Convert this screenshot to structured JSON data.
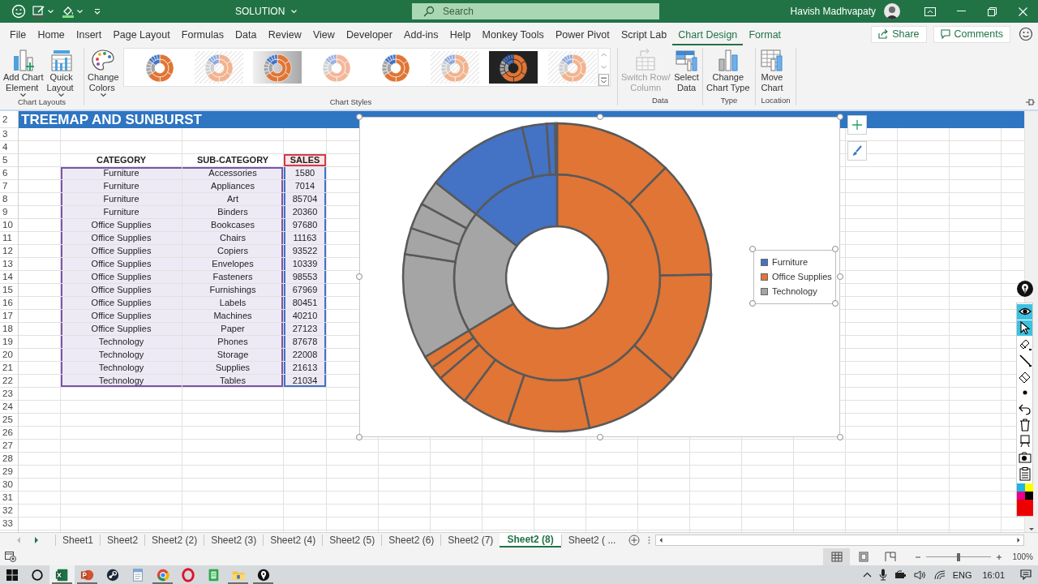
{
  "title_bar": {
    "document_title": "SOLUTION",
    "search_placeholder": "Search",
    "user_name": "Havish Madhvapaty"
  },
  "menu_tabs": [
    {
      "label": "File",
      "selected": false,
      "contextual": false
    },
    {
      "label": "Home",
      "selected": false,
      "contextual": false
    },
    {
      "label": "Insert",
      "selected": false,
      "contextual": false
    },
    {
      "label": "Page Layout",
      "selected": false,
      "contextual": false
    },
    {
      "label": "Formulas",
      "selected": false,
      "contextual": false
    },
    {
      "label": "Data",
      "selected": false,
      "contextual": false
    },
    {
      "label": "Review",
      "selected": false,
      "contextual": false
    },
    {
      "label": "View",
      "selected": false,
      "contextual": false
    },
    {
      "label": "Developer",
      "selected": false,
      "contextual": false
    },
    {
      "label": "Add-ins",
      "selected": false,
      "contextual": false
    },
    {
      "label": "Help",
      "selected": false,
      "contextual": false
    },
    {
      "label": "Monkey Tools",
      "selected": false,
      "contextual": false
    },
    {
      "label": "Power Pivot",
      "selected": false,
      "contextual": false
    },
    {
      "label": "Script Lab",
      "selected": false,
      "contextual": false
    },
    {
      "label": "Chart Design",
      "selected": true,
      "contextual": true
    },
    {
      "label": "Format",
      "selected": false,
      "contextual": true
    }
  ],
  "share_button": "Share",
  "comments_button": "Comments",
  "ribbon": {
    "groups": [
      {
        "label": "Chart Layouts",
        "buttons": [
          {
            "label": "Add Chart\nElement",
            "menu": true,
            "disabled": false
          },
          {
            "label": "Quick\nLayout",
            "menu": true,
            "disabled": false
          }
        ]
      },
      {
        "label": "Chart Styles",
        "buttons": [
          {
            "label": "Change\nColors",
            "menu": true,
            "disabled": false
          }
        ],
        "styles": [
          {
            "kind": "plain"
          },
          {
            "kind": "hatched"
          },
          {
            "kind": "shaded"
          },
          {
            "kind": "pastel"
          },
          {
            "kind": "plain"
          },
          {
            "kind": "hatched"
          },
          {
            "kind": "dark"
          },
          {
            "kind": "hatched"
          }
        ]
      },
      {
        "label": "Data",
        "buttons": [
          {
            "label": "Switch Row/\nColumn",
            "menu": false,
            "disabled": true
          },
          {
            "label": "Select\nData",
            "menu": false,
            "disabled": false
          }
        ]
      },
      {
        "label": "Type",
        "buttons": [
          {
            "label": "Change\nChart Type",
            "menu": false,
            "disabled": false
          }
        ]
      },
      {
        "label": "Location",
        "buttons": [
          {
            "label": "Move\nChart",
            "menu": false,
            "disabled": false
          }
        ]
      }
    ]
  },
  "sheet": {
    "title": "TREEMAP AND SUNBURST",
    "row_numbers": [
      "2",
      "3",
      "4",
      "5",
      "6",
      "7",
      "8",
      "9",
      "10",
      "11",
      "12",
      "13",
      "14",
      "15",
      "16",
      "17",
      "18",
      "19",
      "20",
      "21",
      "22",
      "23",
      "24",
      "25",
      "26",
      "27",
      "28",
      "29",
      "30",
      "31",
      "32",
      "33"
    ],
    "table": {
      "columns": [
        "CATEGORY",
        "SUB-CATEGORY",
        "SALES"
      ],
      "rows": [
        {
          "category": "Furniture",
          "sub_category": "Accessories",
          "sales": "1580"
        },
        {
          "category": "Furniture",
          "sub_category": "Appliances",
          "sales": "7014"
        },
        {
          "category": "Furniture",
          "sub_category": "Art",
          "sales": "85704"
        },
        {
          "category": "Furniture",
          "sub_category": "Binders",
          "sales": "20360"
        },
        {
          "category": "Office Supplies",
          "sub_category": "Bookcases",
          "sales": "97680"
        },
        {
          "category": "Office Supplies",
          "sub_category": "Chairs",
          "sales": "11163"
        },
        {
          "category": "Office Supplies",
          "sub_category": "Copiers",
          "sales": "93522"
        },
        {
          "category": "Office Supplies",
          "sub_category": "Envelopes",
          "sales": "10339"
        },
        {
          "category": "Office Supplies",
          "sub_category": "Fasteners",
          "sales": "98553"
        },
        {
          "category": "Office Supplies",
          "sub_category": "Furnishings",
          "sales": "67969"
        },
        {
          "category": "Office Supplies",
          "sub_category": "Labels",
          "sales": "80451"
        },
        {
          "category": "Office Supplies",
          "sub_category": "Machines",
          "sales": "40210"
        },
        {
          "category": "Office Supplies",
          "sub_category": "Paper",
          "sales": "27123"
        },
        {
          "category": "Technology",
          "sub_category": "Phones",
          "sales": "87678"
        },
        {
          "category": "Technology",
          "sub_category": "Storage",
          "sales": "22008"
        },
        {
          "category": "Technology",
          "sub_category": "Supplies",
          "sales": "21613"
        },
        {
          "category": "Technology",
          "sub_category": "Tables",
          "sales": "21034"
        }
      ]
    }
  },
  "chart": {
    "selected": true,
    "legend": {
      "selected": true,
      "items": [
        {
          "label": "Furniture",
          "color": "#4472c4"
        },
        {
          "label": "Office Supplies",
          "color": "#e07535"
        },
        {
          "label": "Technology",
          "color": "#a5a5a5"
        }
      ]
    }
  },
  "pen_toolbar": {
    "tools": [
      {
        "selected": true
      },
      {
        "selected": true
      },
      {
        "selected": false
      },
      {
        "selected": false
      },
      {
        "selected": false
      },
      {
        "selected": false
      },
      {
        "selected": false
      },
      {
        "selected": false
      },
      {
        "selected": false
      },
      {
        "selected": false
      },
      {
        "selected": false
      }
    ],
    "colors": [
      {
        "color": "#1eb4e6"
      },
      {
        "color": "#ffff00"
      },
      {
        "color": "#e6008c"
      },
      {
        "color": "#000000"
      },
      {
        "color": "#ee0000"
      }
    ]
  },
  "sheet_tabs": [
    {
      "label": "Sheet1",
      "selected": false
    },
    {
      "label": "Sheet2",
      "selected": false
    },
    {
      "label": "Sheet2 (2)",
      "selected": false
    },
    {
      "label": "Sheet2 (3)",
      "selected": false
    },
    {
      "label": "Sheet2 (4)",
      "selected": false
    },
    {
      "label": "Sheet2 (5)",
      "selected": false
    },
    {
      "label": "Sheet2 (6)",
      "selected": false
    },
    {
      "label": "Sheet2 (7)",
      "selected": false
    },
    {
      "label": "Sheet2 (8)",
      "selected": true
    },
    {
      "label": "Sheet2 ( ...",
      "selected": false
    }
  ],
  "status_bar": {
    "views": [
      {
        "selected": true
      },
      {
        "selected": false
      },
      {
        "selected": false
      }
    ],
    "zoom_slider": {
      "level": 0.5
    },
    "zoom": "100%"
  },
  "taskbar": {
    "apps": [
      {
        "selected": true,
        "running": true
      },
      {
        "selected": false,
        "running": true
      },
      {
        "selected": false,
        "running": false
      },
      {
        "selected": false,
        "running": false
      },
      {
        "selected": false,
        "running": true
      },
      {
        "selected": false,
        "running": false
      },
      {
        "selected": false,
        "running": false
      },
      {
        "selected": false,
        "running": true
      },
      {
        "selected": false,
        "running": true
      }
    ],
    "language": "ENG",
    "time": "16:01"
  }
}
